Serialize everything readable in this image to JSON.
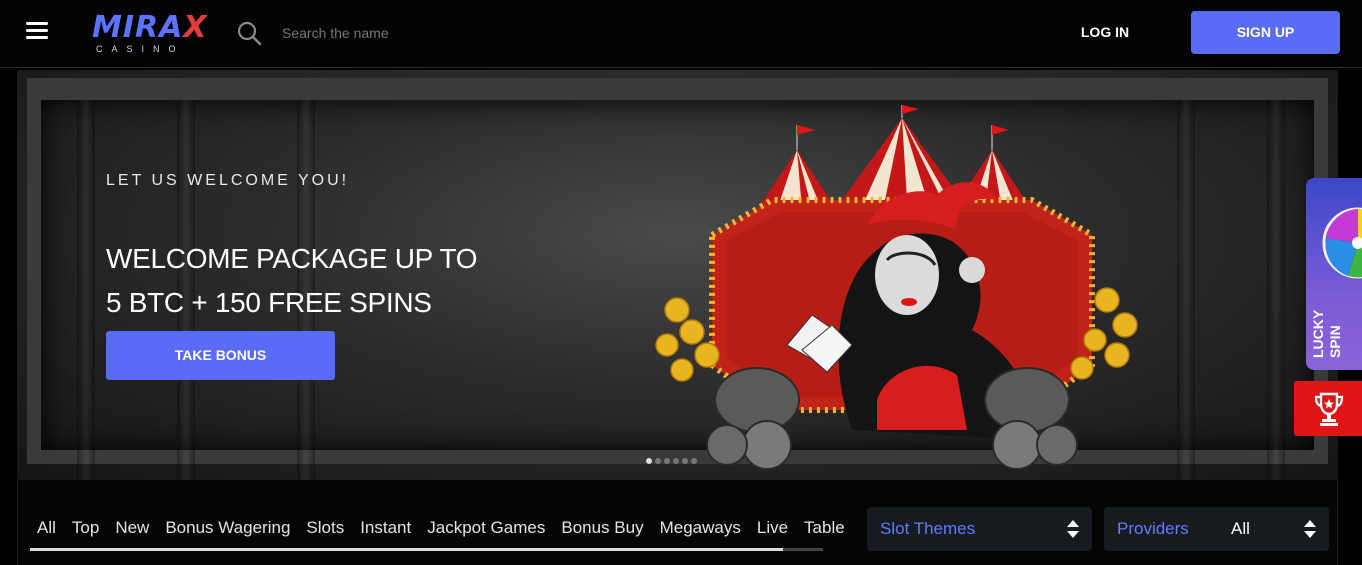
{
  "header": {
    "menu_icon": "hamburger-icon",
    "logo": {
      "word_a": "MIRA",
      "word_b": "X",
      "sub": "CASINO"
    },
    "search": {
      "placeholder": "Search the name",
      "icon": "search-icon"
    },
    "login_label": "LOG IN",
    "signup_label": "SIGN UP"
  },
  "banner": {
    "eyebrow": "LET US WELCOME YOU!",
    "headline_line1": "WELCOME PACKAGE UP TO",
    "headline_line2": "5 BTC + 150 FREE SPINS",
    "cta_label": "TAKE BONUS",
    "slides_total": 6,
    "active_slide": 1
  },
  "side_widgets": {
    "lucky_spin_line1": "LUCKY",
    "lucky_spin_line2": "SPIN",
    "trophy_icon": "trophy-icon"
  },
  "categories": {
    "tabs": [
      "All",
      "Top",
      "New",
      "Bonus Wagering",
      "Slots",
      "Instant",
      "Jackpot Games",
      "Bonus Buy",
      "Megaways",
      "Live",
      "Table"
    ],
    "scroll_progress": 0.95
  },
  "filters": {
    "slot_themes": {
      "label": "Slot Themes",
      "value": ""
    },
    "providers": {
      "label": "Providers",
      "value": "All"
    }
  },
  "colors": {
    "accent": "#5a6cf7",
    "link_blue": "#5f7cff",
    "trophy_red": "#e01616",
    "background": "#000000"
  }
}
